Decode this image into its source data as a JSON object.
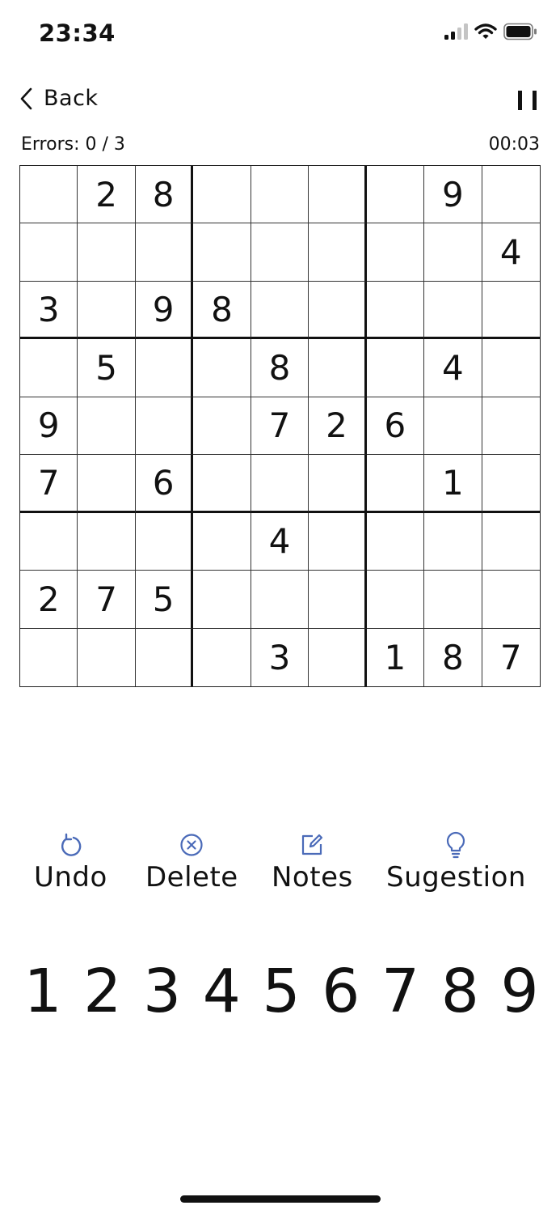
{
  "status_bar": {
    "time": "23:34",
    "signal_icon": "cellular-signal-icon",
    "wifi_icon": "wifi-icon",
    "battery_icon": "battery-icon"
  },
  "nav": {
    "back_label": "Back",
    "back_icon": "chevron-left-icon",
    "pause_icon": "pause-icon"
  },
  "game": {
    "errors_label": "Errors: 0 / 3",
    "timer": "00:03"
  },
  "board": {
    "rows": [
      [
        "",
        "2",
        "8",
        "",
        "",
        "",
        "",
        "9",
        ""
      ],
      [
        "",
        "",
        "",
        "",
        "",
        "",
        "",
        "",
        "4"
      ],
      [
        "3",
        "",
        "9",
        "8",
        "",
        "",
        "",
        "",
        ""
      ],
      [
        "",
        "5",
        "",
        "",
        "8",
        "",
        "",
        "4",
        ""
      ],
      [
        "9",
        "",
        "",
        "",
        "7",
        "2",
        "6",
        "",
        ""
      ],
      [
        "7",
        "",
        "6",
        "",
        "",
        "",
        "",
        "1",
        ""
      ],
      [
        "",
        "",
        "",
        "",
        "4",
        "",
        "",
        "",
        ""
      ],
      [
        "2",
        "7",
        "5",
        "",
        "",
        "",
        "",
        "",
        ""
      ],
      [
        "",
        "",
        "",
        "",
        "3",
        "",
        "1",
        "8",
        "7"
      ]
    ]
  },
  "tools": [
    {
      "label": "Undo",
      "icon": "undo-icon"
    },
    {
      "label": "Delete",
      "icon": "delete-circle-icon"
    },
    {
      "label": "Notes",
      "icon": "edit-note-icon"
    },
    {
      "label": "Sugestion",
      "icon": "lightbulb-icon"
    }
  ],
  "number_pad": [
    "1",
    "2",
    "3",
    "4",
    "5",
    "6",
    "7",
    "8",
    "9"
  ],
  "colors": {
    "tool_icon": "#4a6ab8",
    "text": "#111111",
    "background": "#ffffff",
    "signal_inactive": "#c4c4c4"
  }
}
